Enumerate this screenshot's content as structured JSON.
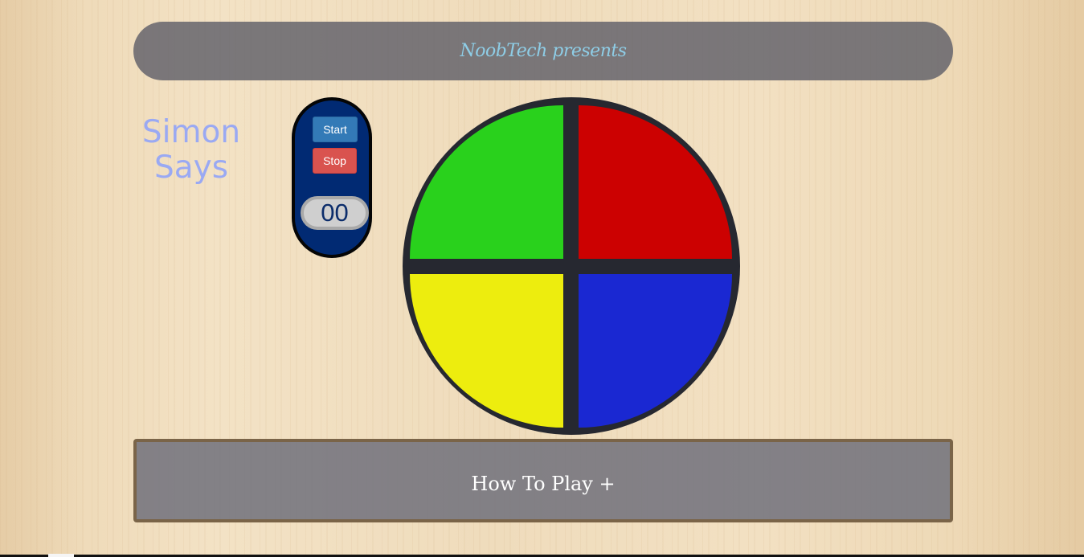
{
  "header": {
    "title": "NoobTech presents"
  },
  "game": {
    "title_line1": "Simon",
    "title_line2": "Says"
  },
  "controls": {
    "start_label": "Start",
    "stop_label": "Stop",
    "counter": "00"
  },
  "board": {
    "pads": [
      {
        "name": "green",
        "color": "#29d11c"
      },
      {
        "name": "red",
        "color": "#cc0101"
      },
      {
        "name": "yellow",
        "color": "#eded0e"
      },
      {
        "name": "blue",
        "color": "#1a28d2"
      }
    ],
    "frame_color": "#262830"
  },
  "instructions": {
    "toggle_label": "How To Play +"
  },
  "colors": {
    "header_text": "#8ecde6",
    "title_text": "#9aa9f3",
    "panel_bg": "#012a73",
    "start_button": "#337ab7",
    "stop_button": "#d9534f"
  }
}
